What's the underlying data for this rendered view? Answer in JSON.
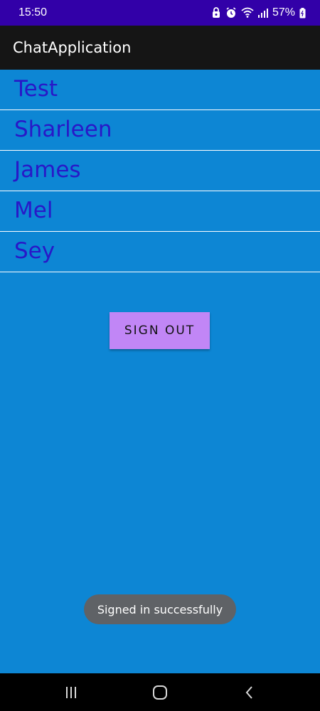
{
  "status_bar": {
    "time": "15:50",
    "battery": "57%",
    "icons": [
      "alarm-lock-icon",
      "alarm-icon",
      "wifi-icon",
      "signal-icon",
      "battery-icon"
    ]
  },
  "app_bar": {
    "title": "ChatApplication"
  },
  "users": [
    {
      "name": "Test"
    },
    {
      "name": "Sharleen"
    },
    {
      "name": "James"
    },
    {
      "name": "Mel"
    },
    {
      "name": "Sey"
    }
  ],
  "sign_out_label": "SIGN OUT",
  "toast": "Signed in successfully",
  "nav_bar": {
    "icons": [
      "recents-icon",
      "home-icon",
      "back-icon"
    ]
  },
  "colors": {
    "status_bar": "#3200a8",
    "app_bar": "#151515",
    "background": "#0d86d4",
    "user_name": "#2818c8",
    "button": "#c186f6",
    "toast": "#5f6266"
  }
}
